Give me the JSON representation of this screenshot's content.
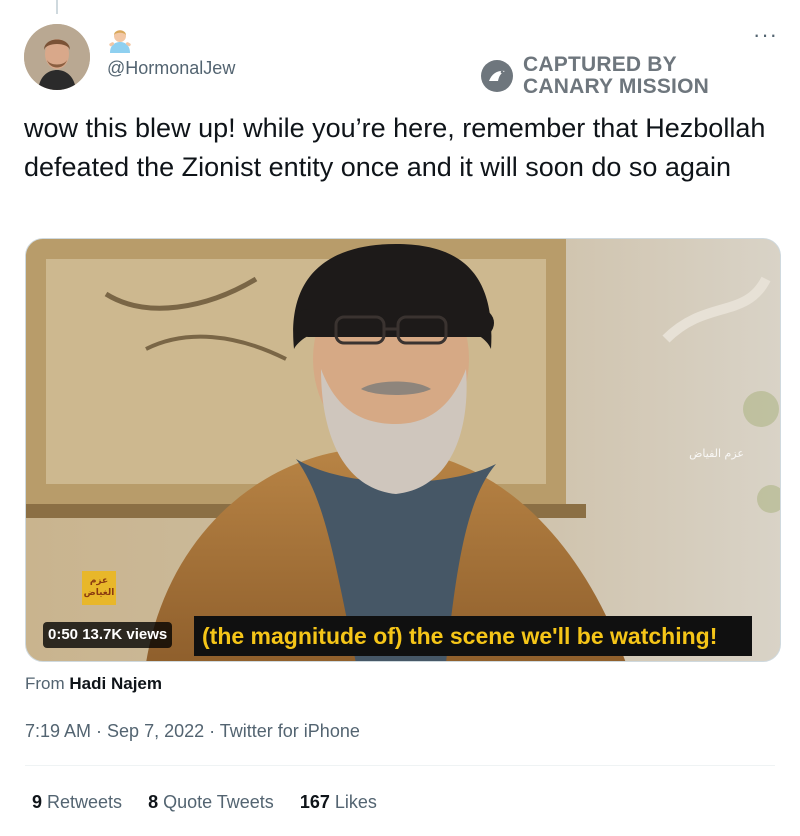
{
  "tweet": {
    "handle": "@HormonalJew",
    "text": "wow this blew up! while you’re here, remember that Hezbollah defeated the Zionist entity once and it will soon do so again",
    "more_label": "···",
    "watermark": {
      "line1": "CAPTURED BY",
      "line2": "CANARY MISSION"
    },
    "media": {
      "subtitle": "(the magnitude of) the scene we'll be watching!",
      "duration": "0:50",
      "views": "13.7K views",
      "arabic_logo_right": "عزم الفياض",
      "arabic_badge_left": "عزم الغياض"
    },
    "source": {
      "prefix": "From",
      "name": "Hadi Najem"
    },
    "timestamp": "7:19 AM · Sep 7, 2022 · Twitter for iPhone",
    "stats": {
      "retweets": {
        "count": "9",
        "label": "Retweets"
      },
      "quotes": {
        "count": "8",
        "label": "Quote Tweets"
      },
      "likes": {
        "count": "167",
        "label": "Likes"
      }
    }
  }
}
